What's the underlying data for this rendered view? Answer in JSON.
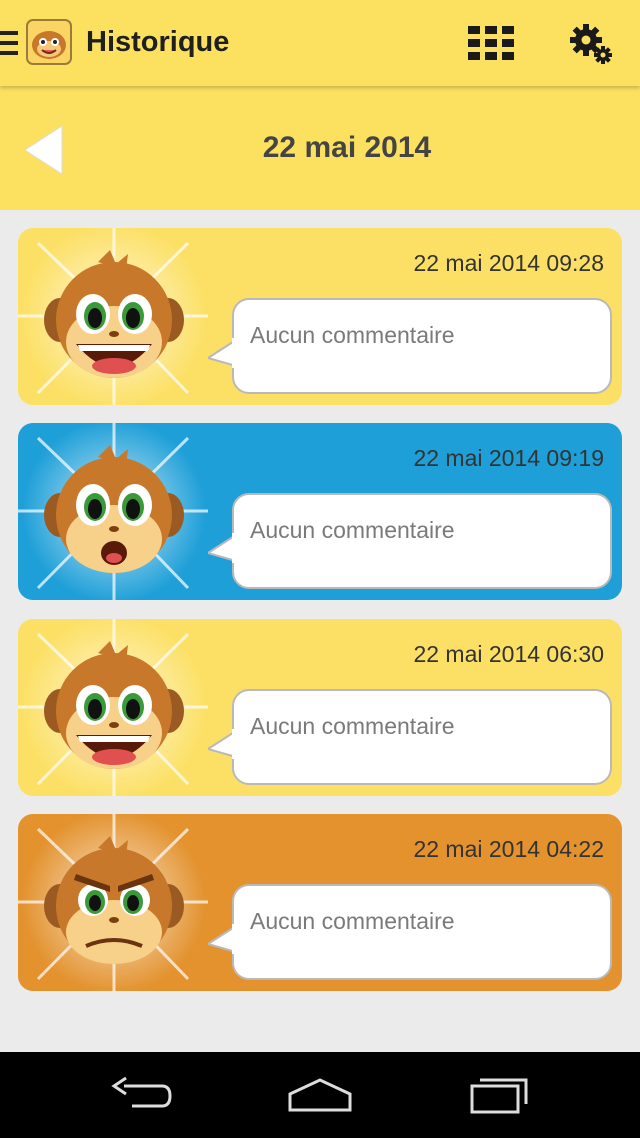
{
  "header": {
    "title": "Historique",
    "icons": [
      "hamburger-menu-icon",
      "app-logo-monkey",
      "grid-view-icon",
      "settings-gears-icon"
    ]
  },
  "date_bar": {
    "date": "22 mai 2014",
    "back_icon": "back-arrow-icon"
  },
  "entries": [
    {
      "timestamp": "22 mai 2014 09:28",
      "comment": "Aucun commentaire",
      "mood": "happy",
      "color": "#fce066"
    },
    {
      "timestamp": "22 mai 2014 09:19",
      "comment": "Aucun commentaire",
      "mood": "shocked",
      "color": "#1e9fd8"
    },
    {
      "timestamp": "22 mai 2014 06:30",
      "comment": "Aucun commentaire",
      "mood": "happy",
      "color": "#fce066"
    },
    {
      "timestamp": "22 mai 2014 04:22",
      "comment": "Aucun commentaire",
      "mood": "angry",
      "color": "#e3922e"
    }
  ],
  "navbar": {
    "icons": [
      "back-nav-icon",
      "home-nav-icon",
      "recents-nav-icon"
    ]
  },
  "colors": {
    "header": "#fce160",
    "background": "#ebebeb"
  }
}
